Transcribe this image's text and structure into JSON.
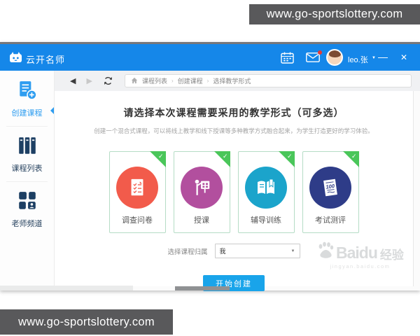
{
  "watermarks": {
    "top": "www.go-sportslottery.com",
    "bottom": "www.go-sportslottery.com"
  },
  "titlebar": {
    "app_name": "云开名师",
    "username": "leo.张",
    "user_caret": "▼",
    "minimize": "—",
    "close": "✕"
  },
  "toolbar": {
    "back": "◀",
    "forward": "▶",
    "separator": "›",
    "breadcrumb": [
      "课程列表",
      "创建课程",
      "选择教学形式"
    ]
  },
  "sidebar": {
    "items": [
      {
        "label": "创建课程",
        "active": true
      },
      {
        "label": "课程列表",
        "active": false
      },
      {
        "label": "老师频道",
        "active": false
      }
    ]
  },
  "main": {
    "heading": "请选择本次课程需要采用的教学形式（可多选）",
    "subheading": "创建一个混合式课程，可以将线上教学和线下授课等多种教学方式融合起来，为学生打造更好的学习体验。",
    "card_check": "✓",
    "cards": [
      {
        "label": "调查问卷",
        "color": "#f25b4b",
        "icon": "survey-icon"
      },
      {
        "label": "授课",
        "color": "#b24f9e",
        "icon": "lecture-icon"
      },
      {
        "label": "辅导训练",
        "color": "#1ba4cb",
        "icon": "tutoring-icon"
      },
      {
        "label": "考试测评",
        "color": "#2e3c88",
        "icon": "exam-icon",
        "icon_text": "100"
      }
    ],
    "ownership": {
      "label": "选择课程归属",
      "value": "我",
      "caret": "▼"
    },
    "submit_label": "开始创建"
  },
  "baidu_watermark": {
    "brand": "Baidu",
    "badge": "经验",
    "url": "jingyan.baidu.com"
  },
  "colors": {
    "titlebar_blue": "#1587e9",
    "accent_blue": "#2e9df0",
    "card_border_green": "#b5dcc5",
    "check_green": "#4ac65a",
    "button_blue": "#19a4ea",
    "sidebar_icon_navy": "#1d3f63",
    "watermark_gray": "#59595b"
  }
}
